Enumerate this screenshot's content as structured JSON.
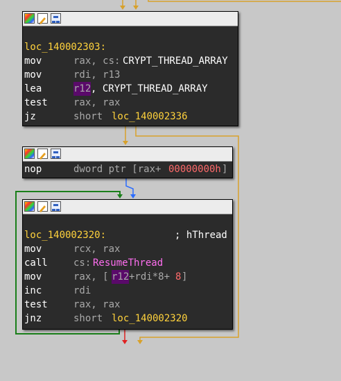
{
  "colors": {
    "background": "#c8c8c8",
    "node_background": "#2b2b2b",
    "label": "#ffd23c",
    "mnemonic": "#ffffff",
    "operand": "#a9a9a9",
    "import": "#ff6ef0",
    "number": "#ff6a6a",
    "register_highlight": "#5a0a6a",
    "edge_true": "#1a7f1a",
    "edge_false": "#d8a12a",
    "edge_normal": "#2a6cff",
    "edge_red": "#e02020"
  },
  "node_title_icons": [
    "graph-icon",
    "edit-icon",
    "graph-overview-icon"
  ],
  "block1": {
    "label": "loc_140002303:",
    "lines": [
      {
        "mn": "mov",
        "a": "rax, cs:",
        "b": "CRYPT_THREAD_ARRAY"
      },
      {
        "mn": "mov",
        "a": "rdi, r13"
      },
      {
        "mn": "lea",
        "reg": "r12",
        "a": ", CRYPT_THREAD_ARRAY"
      },
      {
        "mn": "test",
        "a": "rax, rax"
      },
      {
        "mn": "jz",
        "a": "short ",
        "target": "loc_140002336"
      }
    ]
  },
  "block2": {
    "lines": [
      {
        "mn": "nop",
        "a": "dword ptr [rax+",
        "num": "00000000h",
        "end": "]"
      }
    ]
  },
  "block3": {
    "label": "loc_140002320:",
    "comment": "; hThread",
    "lines": [
      {
        "mn": "mov",
        "a": "rcx, rax"
      },
      {
        "mn": "call",
        "a": "cs:",
        "fn": "ResumeThread"
      },
      {
        "mn": "mov",
        "a": "rax, [",
        "reg": "r12",
        "b": "+rdi*8+",
        "num": "8",
        "end": "]"
      },
      {
        "mn": "inc",
        "a": "rdi"
      },
      {
        "mn": "test",
        "a": "rax, rax"
      },
      {
        "mn": "jnz",
        "a": "short ",
        "target": "loc_140002320"
      }
    ]
  }
}
